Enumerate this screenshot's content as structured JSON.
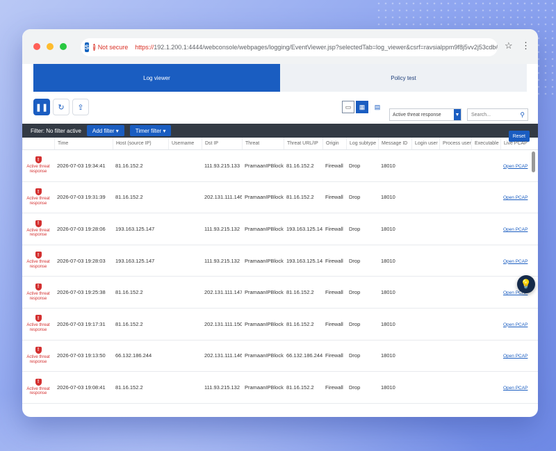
{
  "browser": {
    "site_icon": "S",
    "security": "Not secure",
    "url_protocol": "https://",
    "url_rest": "192.1.200.1:4444/webconsole/webpages/logging/EventViewer.jsp?selectedTab=log_viewer&csrf=ravsialppm9f8j5vv2j53cdb#94234",
    "bookmark_icon": "star-outline-icon",
    "menu_icon": "kebab-menu-icon"
  },
  "tabs": [
    {
      "label": "Log viewer",
      "active": true
    },
    {
      "label": "Policy test",
      "active": false
    }
  ],
  "toolbar": {
    "pause_icon": "pause-icon",
    "refresh_icon": "refresh-icon",
    "export_icon": "export-icon",
    "select_value": "Active threat response",
    "search_placeholder": "Search..."
  },
  "filterbar": {
    "label": "Filter: No filter active",
    "add_filter": "Add filter",
    "timer_filter": "Timer filter",
    "reset": "Reset"
  },
  "columns": [
    "",
    "Time",
    "Host (source IP)",
    "Username",
    "Dst IP",
    "Threat",
    "Threat URL/IP",
    "Origin",
    "Log subtype",
    "Message ID",
    "Login user",
    "Process user",
    "Executable",
    "Live PCAP"
  ],
  "rows": [
    {
      "severity": "Active threat response",
      "time": "2026-07-03 19:34:41",
      "host": "81.16.152.2",
      "username": "",
      "dst": "111.93.215.133",
      "threat": "PramaanIPBlock",
      "turl": "81.16.152.2",
      "origin": "Firewall",
      "subtype": "Drop",
      "msgid": "18010",
      "login": "",
      "proc": "",
      "exec": "",
      "pcap": "Open PCAP"
    },
    {
      "severity": "Active threat response",
      "time": "2026-07-03 19:31:39",
      "host": "81.16.152.2",
      "username": "",
      "dst": "202.131.111.146",
      "threat": "PramaanIPBlock",
      "turl": "81.16.152.2",
      "origin": "Firewall",
      "subtype": "Drop",
      "msgid": "18010",
      "login": "",
      "proc": "",
      "exec": "",
      "pcap": "Open PCAP"
    },
    {
      "severity": "Active threat response",
      "time": "2026-07-03 19:28:06",
      "host": "193.163.125.147",
      "username": "",
      "dst": "111.93.215.132",
      "threat": "PramaanIPBlock",
      "turl": "193.163.125.147",
      "origin": "Firewall",
      "subtype": "Drop",
      "msgid": "18010",
      "login": "",
      "proc": "",
      "exec": "",
      "pcap": "Open PCAP"
    },
    {
      "severity": "Active threat response",
      "time": "2026-07-03 19:28:03",
      "host": "193.163.125.147",
      "username": "",
      "dst": "111.93.215.132",
      "threat": "PramaanIPBlock",
      "turl": "193.163.125.147",
      "origin": "Firewall",
      "subtype": "Drop",
      "msgid": "18010",
      "login": "",
      "proc": "",
      "exec": "",
      "pcap": "Open PCAP"
    },
    {
      "severity": "Active threat response",
      "time": "2026-07-03 19:25:38",
      "host": "81.16.152.2",
      "username": "",
      "dst": "202.131.111.147",
      "threat": "PramaanIPBlock",
      "turl": "81.16.152.2",
      "origin": "Firewall",
      "subtype": "Drop",
      "msgid": "18010",
      "login": "",
      "proc": "",
      "exec": "",
      "pcap": "Open PCAP"
    },
    {
      "severity": "Active threat response",
      "time": "2026-07-03 19:17:31",
      "host": "81.16.152.2",
      "username": "",
      "dst": "202.131.111.150",
      "threat": "PramaanIPBlock",
      "turl": "81.16.152.2",
      "origin": "Firewall",
      "subtype": "Drop",
      "msgid": "18010",
      "login": "",
      "proc": "",
      "exec": "",
      "pcap": "Open PCAP"
    },
    {
      "severity": "Active threat response",
      "time": "2026-07-03 19:13:50",
      "host": "66.132.186.244",
      "username": "",
      "dst": "202.131.111.146",
      "threat": "PramaanIPBlock",
      "turl": "66.132.186.244",
      "origin": "Firewall",
      "subtype": "Drop",
      "msgid": "18010",
      "login": "",
      "proc": "",
      "exec": "",
      "pcap": "Open PCAP"
    },
    {
      "severity": "Active threat response",
      "time": "2026-07-03 19:08:41",
      "host": "81.16.152.2",
      "username": "",
      "dst": "111.93.215.132",
      "threat": "PramaanIPBlock",
      "turl": "81.16.152.2",
      "origin": "Firewall",
      "subtype": "Drop",
      "msgid": "18010",
      "login": "",
      "proc": "",
      "exec": "",
      "pcap": "Open PCAP"
    }
  ],
  "colors": {
    "accent": "#1a5dc1",
    "danger": "#d32f2f",
    "filterbar": "#333a44"
  },
  "help_icon": "lightbulb-icon"
}
